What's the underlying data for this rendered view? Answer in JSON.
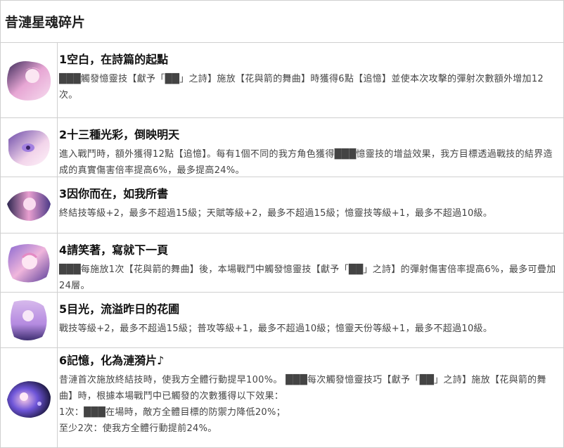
{
  "page": {
    "title": "昔漣星魂碎片"
  },
  "eidolons": [
    {
      "title": "1空白，在詩篇的起點",
      "icon": "portrait-icon-1",
      "desc": [
        "███觸發憶靈技【獻予「██」之詩】施放【花與箭的舞曲】時獲得6點【追憶】並使本次攻擊的彈射次數額外增加12次。"
      ]
    },
    {
      "title": "2十三種光彩，倒映明天",
      "icon": "portrait-icon-2",
      "desc": [
        "進入戰鬥時，額外獲得12點【追憶】。每有1個不同的我方角色獲得███憶靈技的增益效果，我方目標透過戰技的結界造成的真實傷害倍率提高6%，最多提高24%。"
      ]
    },
    {
      "title": "3因你而在，如我所書",
      "icon": "portrait-icon-3",
      "desc": [
        "終結技等級+2，最多不超過15級；天賦等級+2，最多不超過15級；憶靈技等級+1，最多不超過10級。"
      ]
    },
    {
      "title": "4請笑著，寫就下一頁",
      "icon": "portrait-icon-4",
      "desc": [
        "███每施放1次【花與箭的舞曲】後，本場戰鬥中觸發憶靈技【獻予「██」之詩】的彈射傷害倍率提高6%，最多可疊加24層。"
      ]
    },
    {
      "title": "5目光，流溢昨日的花圃",
      "icon": "portrait-icon-5",
      "desc": [
        "戰技等級+2，最多不超過15級；普攻等級+1，最多不超過10級；憶靈天份等級+1，最多不超過10級。"
      ]
    },
    {
      "title": "6記憶，化為漣漪片♪",
      "icon": "portrait-icon-6",
      "desc": [
        "昔漣首次施放終結技時，使我方全體行動提早100%。 ███每次觸發憶靈技巧【獻予「██」之詩】施放【花與箭的舞曲】時，根據本場戰鬥中已觸發的次數獲得以下效果：",
        "1次：███在場時，敵方全體目標的防禦力降低20%；",
        "至少2次：使我方全體行動提前24%。"
      ]
    }
  ],
  "colors": {
    "border": "#cfcfcf",
    "title_text": "#111111",
    "desc_text": "#444444",
    "portrait_pink": "#e7a6d4",
    "portrait_purple": "#7b5cc7"
  }
}
